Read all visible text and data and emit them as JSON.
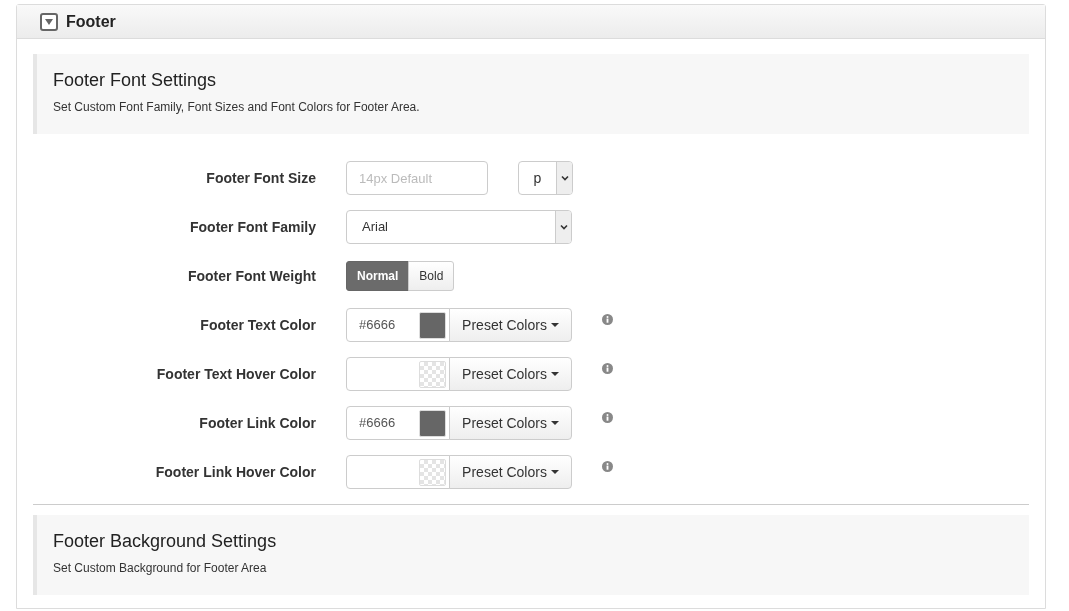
{
  "panel": {
    "title": "Footer",
    "expanded": true
  },
  "sections": [
    {
      "title": "Footer Font Settings",
      "description": "Set Custom Font Family, Font Sizes and Font Colors for Footer Area.",
      "fields": [
        {
          "kind": "size",
          "label": "Footer Font Size",
          "placeholder": "14px Default",
          "unit": "p"
        },
        {
          "kind": "select",
          "label": "Footer Font Family",
          "value": "Arial"
        },
        {
          "kind": "toggle",
          "label": "Footer Font Weight",
          "options": [
            {
              "label": "Normal",
              "selected": true
            },
            {
              "label": "Bold",
              "selected": false
            }
          ]
        },
        {
          "kind": "color",
          "label": "Footer Text Color",
          "value": "#6666",
          "color": "#666666",
          "button": "Preset Colors"
        },
        {
          "kind": "color",
          "label": "Footer Text Hover Color",
          "button": "Preset Colors"
        },
        {
          "kind": "color",
          "label": "Footer Link Color",
          "value": "#6666",
          "color": "#666666",
          "button": "Preset Colors"
        },
        {
          "kind": "color",
          "label": "Footer Link Hover Color",
          "button": "Preset Colors"
        }
      ]
    },
    {
      "title": "Footer Background Settings",
      "description": "Set Custom Background for Footer Area"
    }
  ]
}
